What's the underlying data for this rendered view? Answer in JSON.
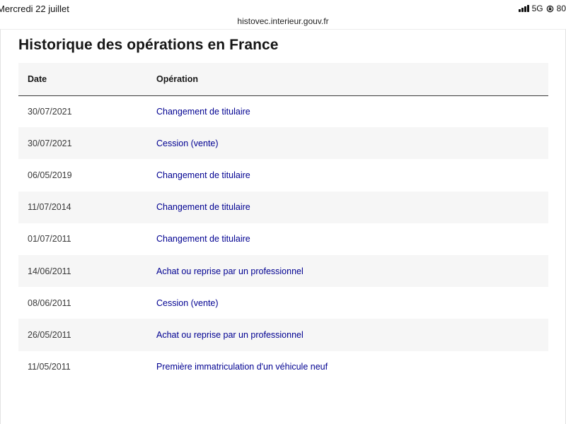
{
  "status_bar": {
    "time": "Mercredi 22 juillet",
    "network": "5G",
    "battery": "80"
  },
  "browser": {
    "url": "histovec.interieur.gouv.fr"
  },
  "page": {
    "title": "Historique des opérations en France",
    "table": {
      "columns": [
        "Date",
        "Opération"
      ],
      "rows": [
        {
          "date": "30/07/2021",
          "operation": "Changement de titulaire"
        },
        {
          "date": "30/07/2021",
          "operation": "Cession (vente)"
        },
        {
          "date": "06/05/2019",
          "operation": "Changement de titulaire"
        },
        {
          "date": "11/07/2014",
          "operation": "Changement de titulaire"
        },
        {
          "date": "01/07/2011",
          "operation": "Changement de titulaire"
        },
        {
          "date": "14/06/2011",
          "operation": "Achat ou reprise par un professionnel"
        },
        {
          "date": "08/06/2011",
          "operation": "Cession (vente)"
        },
        {
          "date": "26/05/2011",
          "operation": "Achat ou reprise par un professionnel"
        },
        {
          "date": "11/05/2011",
          "operation": "Première immatriculation d'un véhicule neuf"
        }
      ]
    }
  },
  "colors": {
    "link": "#000091",
    "stripe": "#f6f6f6",
    "text": "#161616"
  }
}
